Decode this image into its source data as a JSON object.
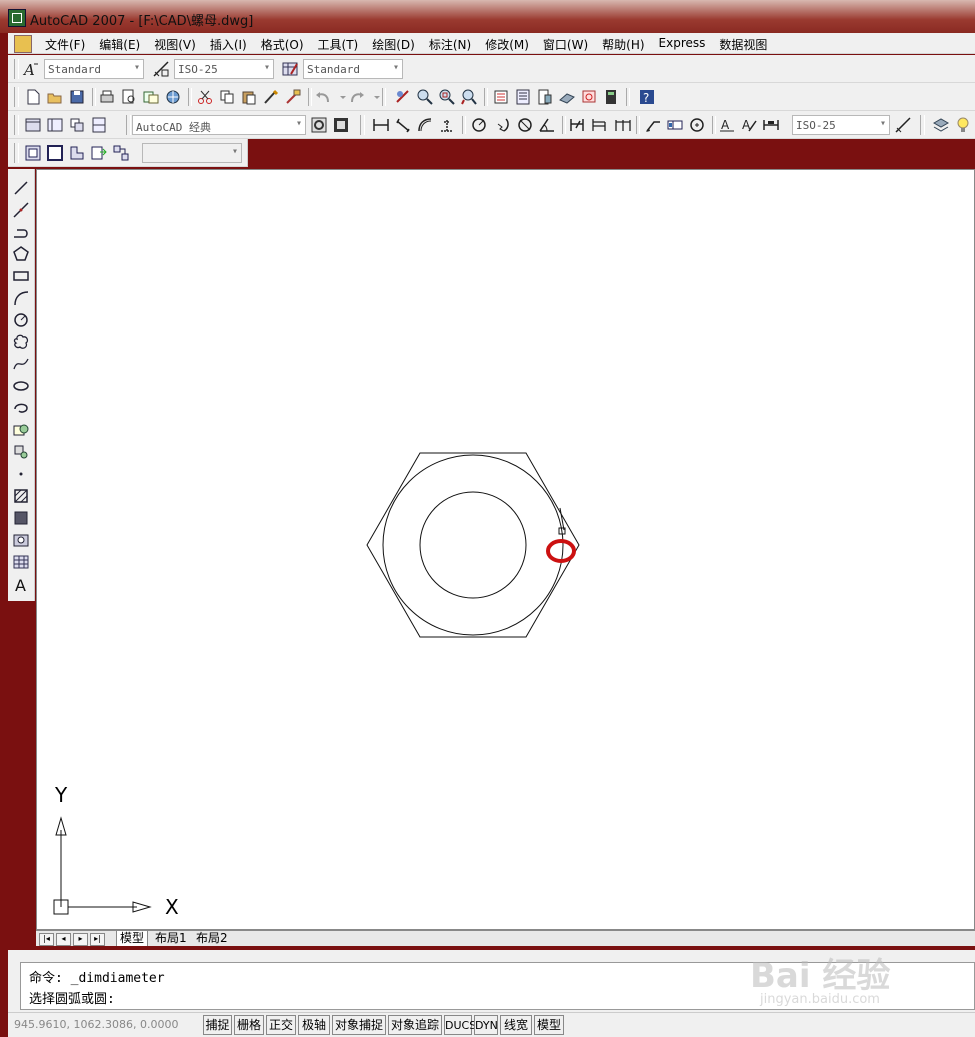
{
  "window": {
    "title": "AutoCAD 2007 - [F:\\CAD\\螺母.dwg]"
  },
  "menu": [
    "文件(F)",
    "编辑(E)",
    "视图(V)",
    "插入(I)",
    "格式(O)",
    "工具(T)",
    "绘图(D)",
    "标注(N)",
    "修改(M)",
    "窗口(W)",
    "帮助(H)",
    "Express",
    "数据视图"
  ],
  "styles_toolbar": {
    "text_style": "Standard",
    "dim_style": "ISO-25",
    "table_style": "Standard"
  },
  "workspace_toolbar": {
    "workspace": "AutoCAD 经典",
    "dim_style_2": "ISO-25"
  },
  "layer_toolbar": {
    "combo": ""
  },
  "ucs": {
    "y_label": "Y",
    "x_label": "X"
  },
  "tabs": {
    "model": "模型",
    "layout1": "布局1",
    "layout2": "布局2"
  },
  "command": {
    "line1": "命令: _dimdiameter",
    "line2": "选择圆弧或圆:"
  },
  "status": {
    "coords": "945.9610, 1062.3086, 0.0000",
    "buttons": [
      "捕捉",
      "栅格",
      "正交",
      "极轴",
      "对象捕捉",
      "对象追踪",
      "DUCS",
      "DYN",
      "线宽",
      "模型"
    ]
  },
  "watermark": {
    "brand": "Bai 经验",
    "url": "jingyan.baidu.com"
  },
  "colors": {
    "highlight": "#cc1111",
    "title_bar": "#9a3a30"
  }
}
